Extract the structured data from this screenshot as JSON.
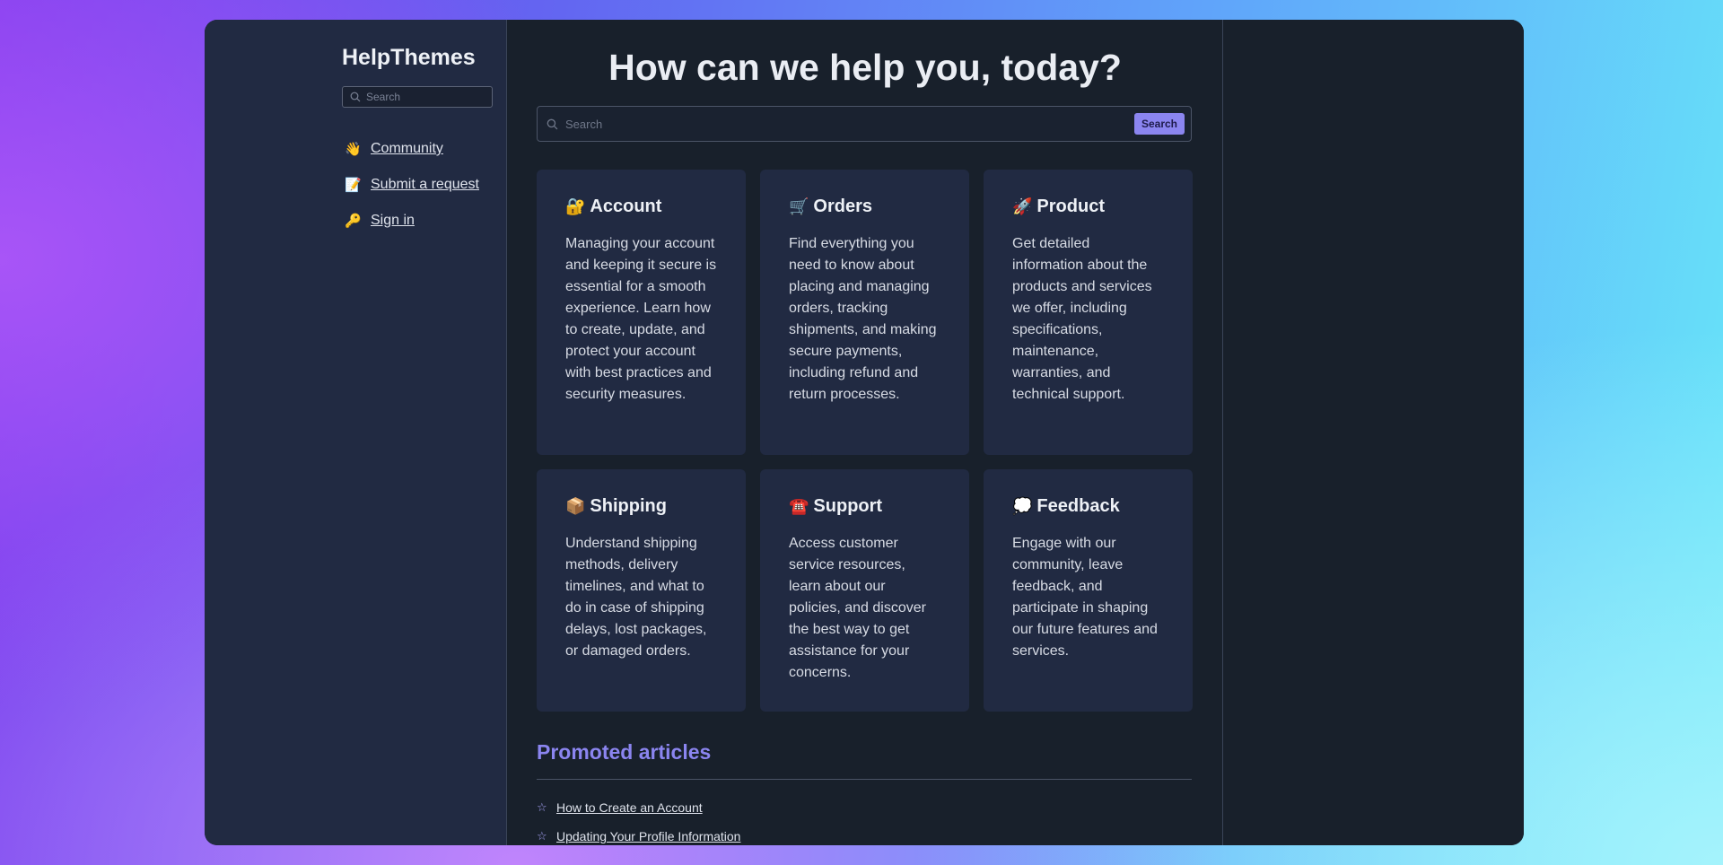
{
  "sidebar": {
    "brand": "HelpThemes",
    "search_placeholder": "Search",
    "items": [
      {
        "emoji": "👋",
        "label": "Community"
      },
      {
        "emoji": "📝",
        "label": "Submit a request"
      },
      {
        "emoji": "🔑",
        "label": "Sign in"
      }
    ]
  },
  "main": {
    "headline": "How can we help you, today?",
    "search_placeholder": "Search",
    "search_button": "Search",
    "categories": [
      {
        "emoji": "🔐",
        "title": "Account",
        "desc": "Managing your account and keeping it secure is essential for a smooth experience. Learn how to create, update, and protect your account with best practices and security measures."
      },
      {
        "emoji": "🛒",
        "title": "Orders",
        "desc": "Find everything you need to know about placing and managing orders, tracking shipments, and making secure payments, including refund and return processes."
      },
      {
        "emoji": "🚀",
        "title": "Product",
        "desc": "Get detailed information about the products and services we offer, including specifications, maintenance, warranties, and technical support."
      },
      {
        "emoji": "📦",
        "title": "Shipping",
        "desc": "Understand shipping methods, delivery timelines, and what to do in case of shipping delays, lost packages, or damaged orders."
      },
      {
        "emoji": "☎️",
        "title": "Support",
        "desc": "Access customer service resources, learn about our policies, and discover the best way to get assistance for your concerns."
      },
      {
        "emoji": "💭",
        "title": "Feedback",
        "desc": "Engage with our community, leave feedback, and participate in shaping our future features and services."
      }
    ],
    "promoted_title": "Promoted articles",
    "articles": [
      "How to Create an Account",
      "Updating Your Profile Information"
    ]
  },
  "colors": {
    "accent": "#8b85f0",
    "panel": "#212a42",
    "background": "#18202b"
  }
}
